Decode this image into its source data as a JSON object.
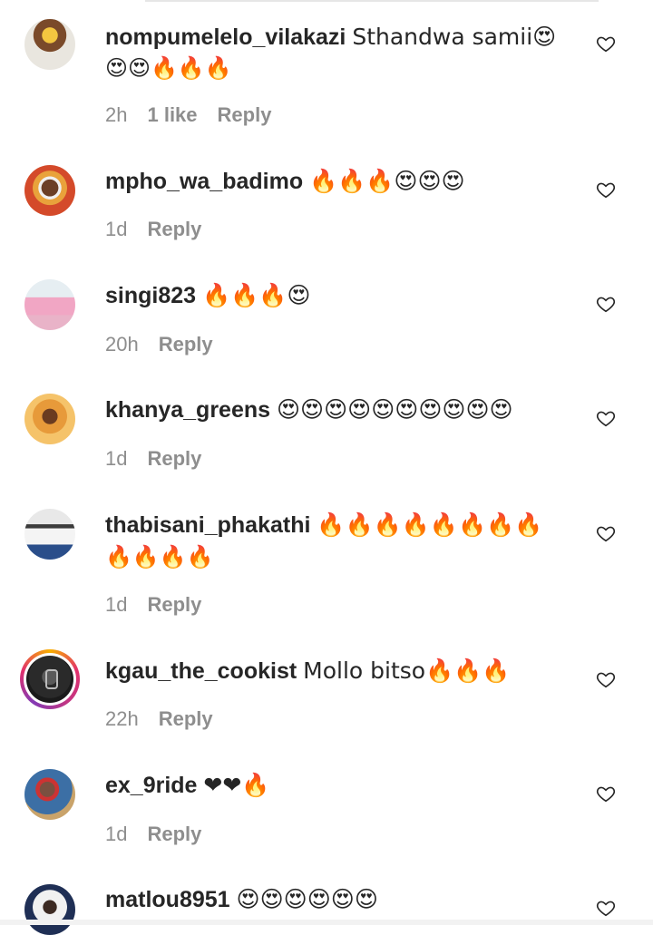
{
  "comments": [
    {
      "username": "nompumelelo_vilakazi",
      "text": "Sthandwa samii😍",
      "text_line2": "😍😍🔥🔥🔥",
      "time": "2h",
      "likes": "1 like",
      "reply": "Reply",
      "avatar_icon": "profile-avatar"
    },
    {
      "username": "mpho_wa_badimo",
      "text": "🔥🔥🔥😍😍😍",
      "time": "1d",
      "reply": "Reply",
      "avatar_icon": "profile-avatar"
    },
    {
      "username": "singi823",
      "text": "🔥🔥🔥😍",
      "time": "20h",
      "reply": "Reply",
      "avatar_icon": "profile-avatar"
    },
    {
      "username": "khanya_greens",
      "text": "😍😍😍😍😍😍😍😍😍😍",
      "time": "1d",
      "reply": "Reply",
      "avatar_icon": "profile-avatar"
    },
    {
      "username": "thabisani_phakathi",
      "text": "🔥🔥🔥🔥🔥🔥🔥🔥",
      "text_line2": "🔥🔥🔥🔥",
      "time": "1d",
      "reply": "Reply",
      "avatar_icon": "profile-avatar"
    },
    {
      "username": "kgau_the_cookist",
      "text": "Mollo bitso🔥🔥🔥",
      "time": "22h",
      "reply": "Reply",
      "avatar_icon": "story-ring-avatar"
    },
    {
      "username": "ex_9ride",
      "text": "❤❤🔥",
      "time": "1d",
      "reply": "Reply",
      "avatar_icon": "profile-avatar"
    },
    {
      "username": "matlou8951",
      "text": "😍😍😍😍😍😍",
      "avatar_icon": "profile-avatar"
    }
  ],
  "icons": {
    "like": "heart-outline-icon"
  },
  "colors": {
    "text": "#262626",
    "meta": "#8e8e8e",
    "background": "#ffffff"
  }
}
